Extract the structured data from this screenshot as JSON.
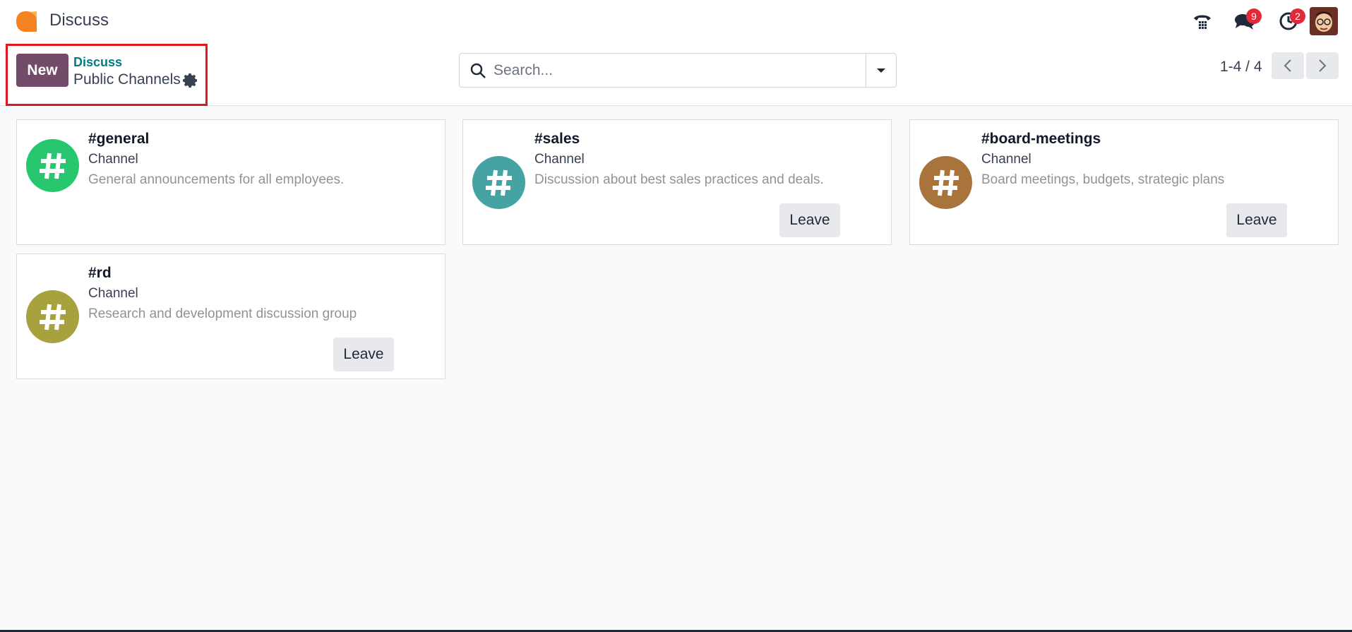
{
  "app": {
    "name": "Discuss"
  },
  "systray": {
    "messages_count": "9",
    "activities_count": "2"
  },
  "control_panel": {
    "new_label": "New",
    "breadcrumb_parent": "Discuss",
    "breadcrumb_current": "Public Channels",
    "search_placeholder": "Search...",
    "pager_value": "1-4 / 4"
  },
  "channels": [
    {
      "name": "#general",
      "type": "Channel",
      "description": "General announcements for all employees.",
      "color": "#28c76f",
      "leave_label": ""
    },
    {
      "name": "#sales",
      "type": "Channel",
      "description": "Discussion about best sales practices and deals.",
      "color": "#45a3a3",
      "leave_label": "Leave"
    },
    {
      "name": "#board-meetings",
      "type": "Channel",
      "description": "Board meetings, budgets, strategic plans",
      "color": "#a8743c",
      "leave_label": "Leave"
    },
    {
      "name": "#rd",
      "type": "Channel",
      "description": "Research and development discussion group",
      "color": "#a8a23e",
      "leave_label": "Leave"
    }
  ],
  "colors": {
    "brand": "#714b67",
    "link": "#017e84",
    "badge": "#e02a3a",
    "highlight": "#e3151f"
  }
}
